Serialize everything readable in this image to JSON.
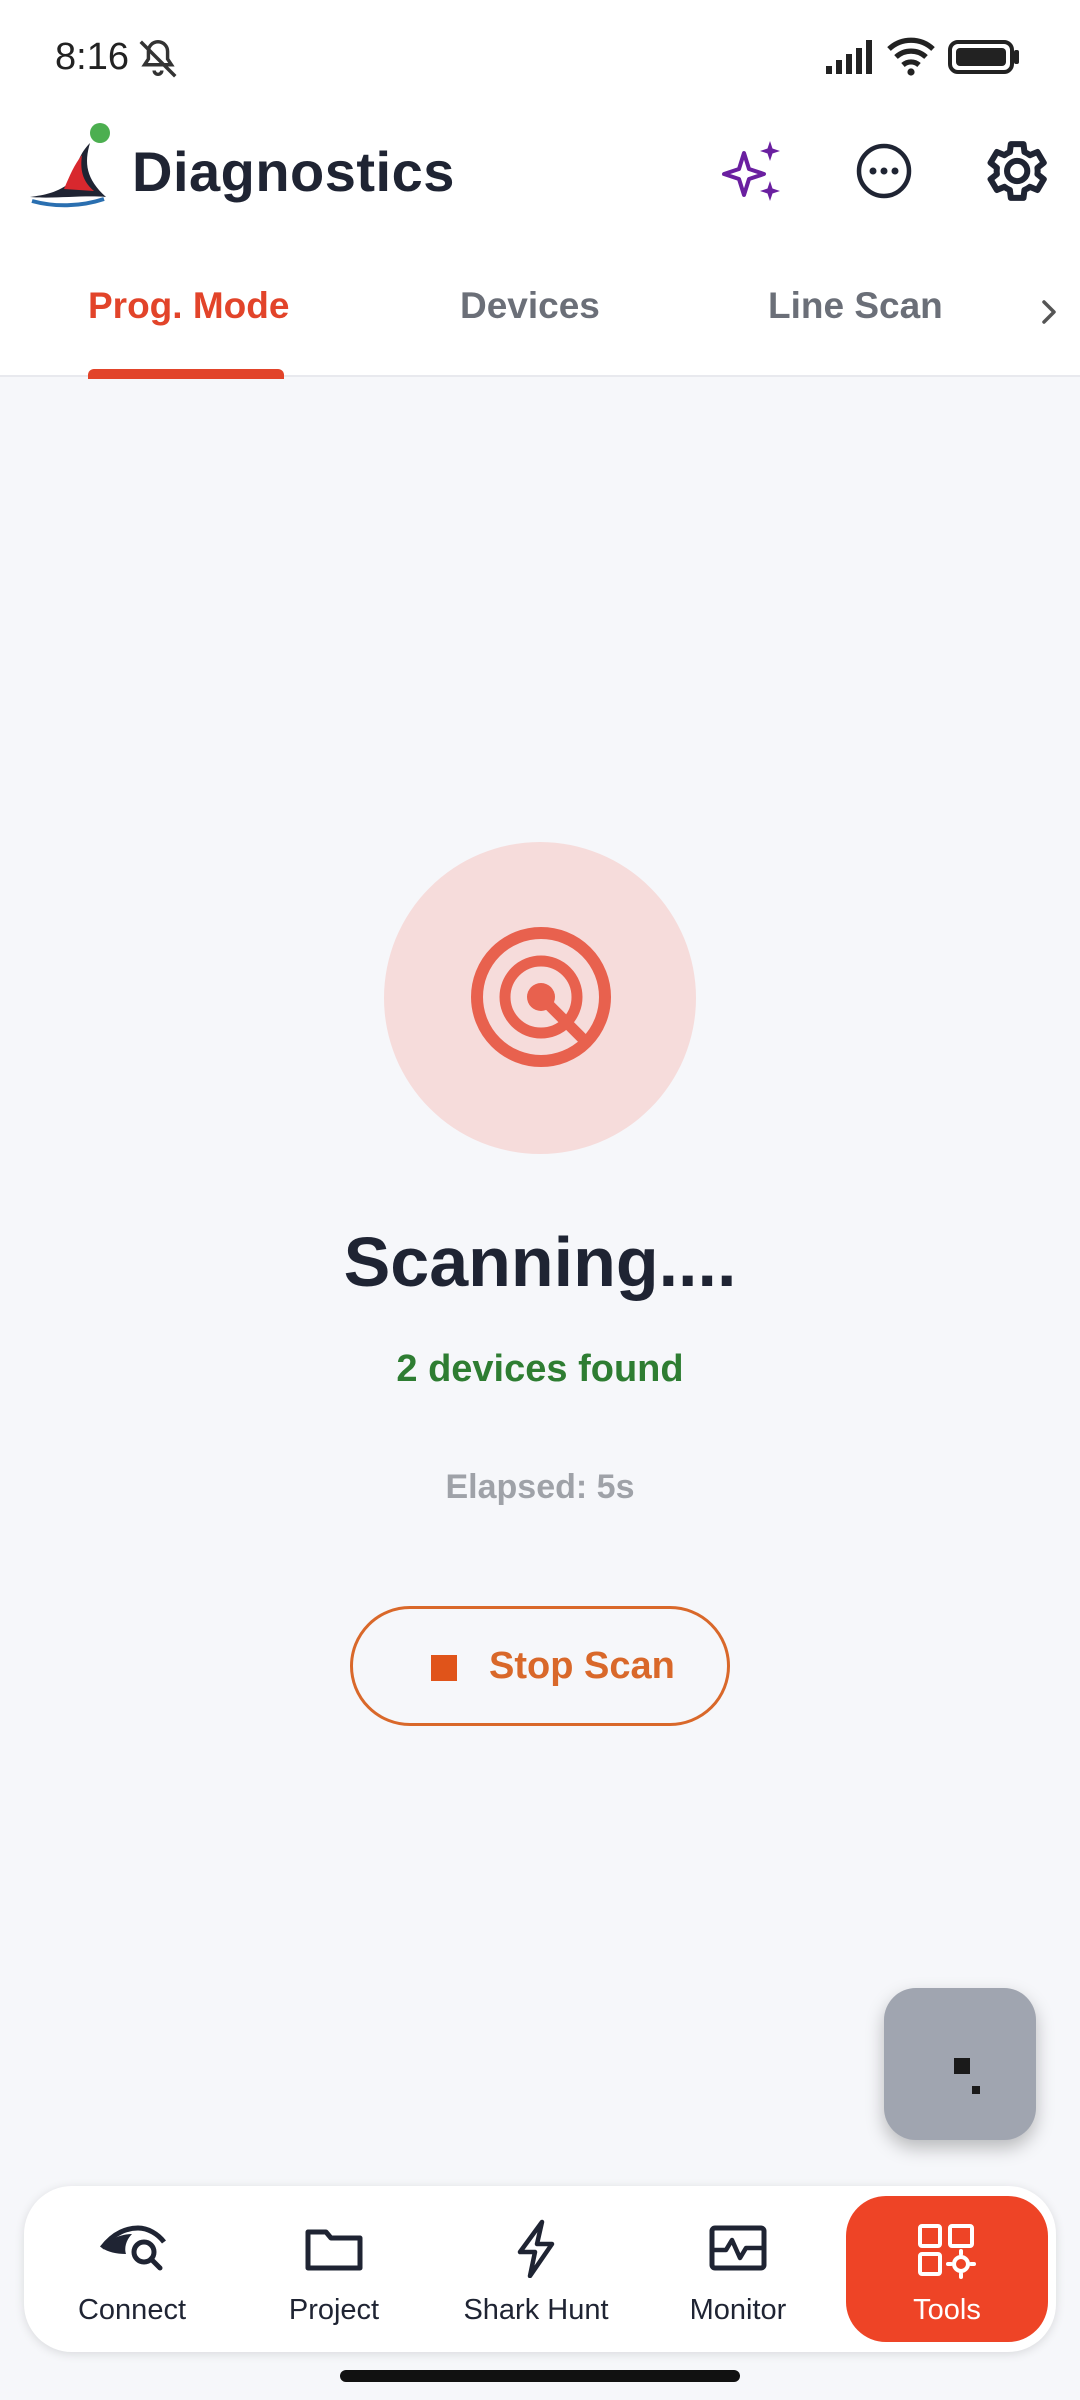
{
  "status_bar": {
    "time": "8:16"
  },
  "app_bar": {
    "title": "Diagnostics",
    "status_dot_color": "#4caf50"
  },
  "tabs": [
    {
      "label": "Prog. Mode",
      "active": true
    },
    {
      "label": "Devices",
      "active": false
    },
    {
      "label": "Line Scan",
      "active": false
    }
  ],
  "scan": {
    "title": "Scanning....",
    "found": "2 devices found",
    "elapsed": "Elapsed: 5s",
    "stop_label": "Stop Scan"
  },
  "bottom_nav": [
    {
      "label": "Connect",
      "icon": "eye-search-icon",
      "active": false
    },
    {
      "label": "Project",
      "icon": "folder-icon",
      "active": false
    },
    {
      "label": "Shark Hunt",
      "icon": "lightning-icon",
      "active": false
    },
    {
      "label": "Monitor",
      "icon": "monitor-pulse-icon",
      "active": false
    },
    {
      "label": "Tools",
      "icon": "tools-grid-icon",
      "active": true
    }
  ],
  "colors": {
    "accent": "#e2442a",
    "found_green": "#2e7d32",
    "stop_orange": "#d9682a",
    "ai_purple": "#6a1fa0"
  }
}
